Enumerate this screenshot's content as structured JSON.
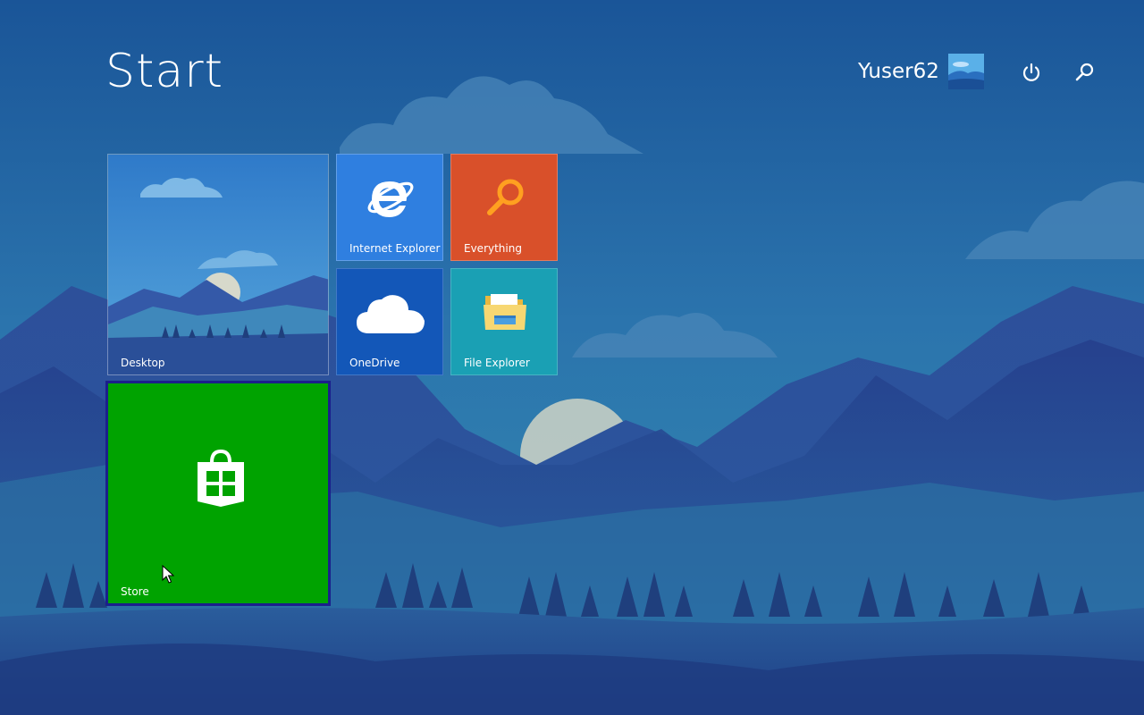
{
  "header": {
    "title": "Start",
    "user_name": "Yuser62"
  },
  "icons": {
    "avatar": "user-avatar",
    "power": "power-icon",
    "search": "search-icon"
  },
  "tiles": [
    {
      "label": "Desktop",
      "icon": "desktop-wallpaper-preview",
      "color": "#3a8ad0"
    },
    {
      "label": "Internet Explorer",
      "icon": "internet-explorer-icon",
      "color": "#2f7fe0"
    },
    {
      "label": "Everything",
      "icon": "magnifier-icon",
      "color": "#d9502a"
    },
    {
      "label": "OneDrive",
      "icon": "cloud-icon",
      "color": "#1357b8"
    },
    {
      "label": "File Explorer",
      "icon": "folder-icon",
      "color": "#1aa0b4"
    },
    {
      "label": "Store",
      "icon": "store-bag-icon",
      "color": "#00a300"
    }
  ],
  "colors": {
    "background": "#1d5a9c",
    "accent_selected_border": "#1b1f8c"
  }
}
